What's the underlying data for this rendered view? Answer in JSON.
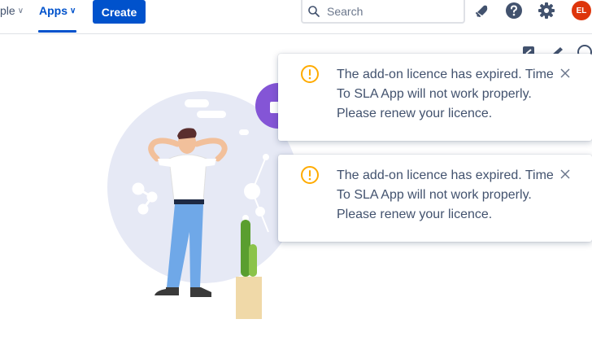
{
  "nav": {
    "people_label_partial": "ple",
    "apps_label": "Apps",
    "create_label": "Create"
  },
  "search": {
    "placeholder": "Search"
  },
  "user": {
    "initials": "EL",
    "avatar_color": "#de350b"
  },
  "colors": {
    "brand": "#0052cc",
    "warning": "#ffab00",
    "text": "#42526e"
  },
  "icons": [
    "notification-bell-icon",
    "help-icon",
    "settings-icon",
    "share-icon",
    "feedback-icon"
  ],
  "flags": [
    {
      "message": "The add-on licence has expired. Time To SLA App will not work properly. Please renew your licence."
    },
    {
      "message": "The add-on licence has expired. Time To SLA App will not work properly. Please renew your licence."
    }
  ]
}
